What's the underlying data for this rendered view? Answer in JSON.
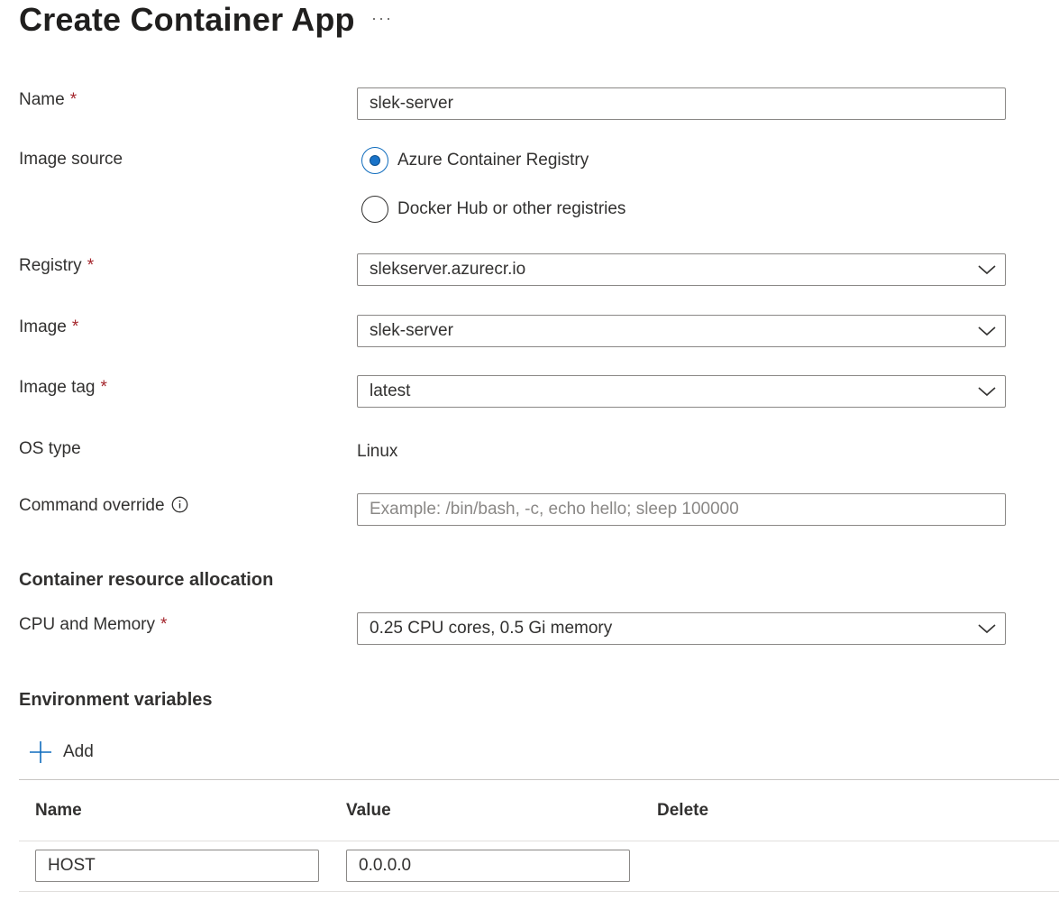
{
  "page": {
    "title": "Create Container App",
    "more_label": "···"
  },
  "form": {
    "required_marker": "*",
    "name": {
      "label": "Name",
      "value": "slek-server"
    },
    "image_source": {
      "label": "Image source",
      "options": [
        {
          "label": "Azure Container Registry",
          "selected": true
        },
        {
          "label": "Docker Hub or other registries",
          "selected": false
        }
      ]
    },
    "registry": {
      "label": "Registry",
      "value": "slekserver.azurecr.io"
    },
    "image": {
      "label": "Image",
      "value": "slek-server"
    },
    "image_tag": {
      "label": "Image tag",
      "value": "latest"
    },
    "os_type": {
      "label": "OS type",
      "value": "Linux"
    },
    "command_override": {
      "label": "Command override",
      "value": "",
      "placeholder": "Example: /bin/bash, -c, echo hello; sleep 100000"
    }
  },
  "resources": {
    "heading": "Container resource allocation",
    "cpu_memory": {
      "label": "CPU and Memory",
      "value": "0.25 CPU cores, 0.5 Gi memory"
    }
  },
  "env": {
    "heading": "Environment variables",
    "add_label": "Add",
    "columns": [
      "Name",
      "Value",
      "Delete"
    ],
    "rows": [
      {
        "name": "HOST",
        "value": "0.0.0.0"
      }
    ]
  },
  "colors": {
    "accent": "#0f6cbd",
    "required": "#a4262c",
    "border": "#8a8886"
  },
  "icons": {
    "more": "more-horizontal-icon",
    "chevron": "chevron-down-icon",
    "info": "info-icon",
    "add": "plus-icon"
  }
}
